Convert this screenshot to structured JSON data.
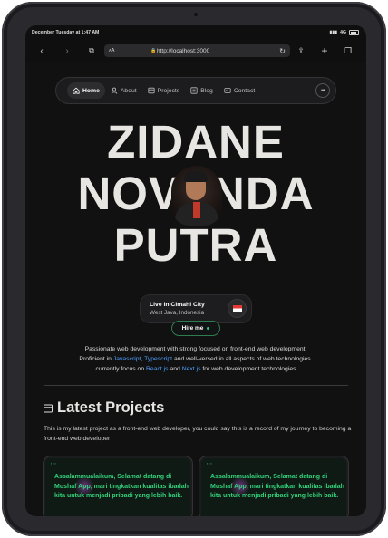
{
  "status_bar": {
    "time": "December Tuesday at 1:47 AM",
    "signal": "4G"
  },
  "browser": {
    "text_size_label": "ᴀA",
    "url": "http://localhost:3000"
  },
  "nav": {
    "items": [
      {
        "label": "Home",
        "icon": "home-icon",
        "active": true
      },
      {
        "label": "About",
        "icon": "user-icon",
        "active": false
      },
      {
        "label": "Projects",
        "icon": "projects-icon",
        "active": false
      },
      {
        "label": "Blog",
        "icon": "blog-icon",
        "active": false
      },
      {
        "label": "Contact",
        "icon": "contact-icon",
        "active": false
      }
    ],
    "more_label": "•••"
  },
  "hero": {
    "line1": "ZIDANE",
    "line2": "NOVANDA",
    "line3": "PUTRA"
  },
  "location": {
    "city": "Live in Cimahi City",
    "region": "West Java, Indonesia"
  },
  "hire_label": "Hire me",
  "bio": {
    "line1": "Passionate web development with strong focused on front-end web development.",
    "line2_pre": "Proficient in ",
    "link_js": "Javascript",
    "comma": ", ",
    "link_ts": "Typescript",
    "line2_post": " and well-versed in all aspects of web technologies.",
    "line3_pre": "currently focus on ",
    "link_react": "React.js",
    "and": " and ",
    "link_next": "Next.js",
    "line3_post": " for web development technologies"
  },
  "projects": {
    "title": "Latest Projects",
    "description": "This is my latest project as a front-end web developer, you could say this is a record of my journey to becoming a front-end web developer",
    "cards": [
      {
        "headline": "Assalammualaikum, Selamat datang di Mushaf App, mari tingkatkan kualitas ibadah kita untuk menjadi pribadi yang lebih baik."
      },
      {
        "headline": "Assalammualaikum, Selamat datang di Mushaf App, mari tingkatkan kualitas ibadah kita untuk menjadi pribadi yang lebih baik."
      }
    ]
  },
  "colors": {
    "link": "#4ea1ff",
    "accent_green": "#34d27b",
    "page_bg": "#111112"
  }
}
